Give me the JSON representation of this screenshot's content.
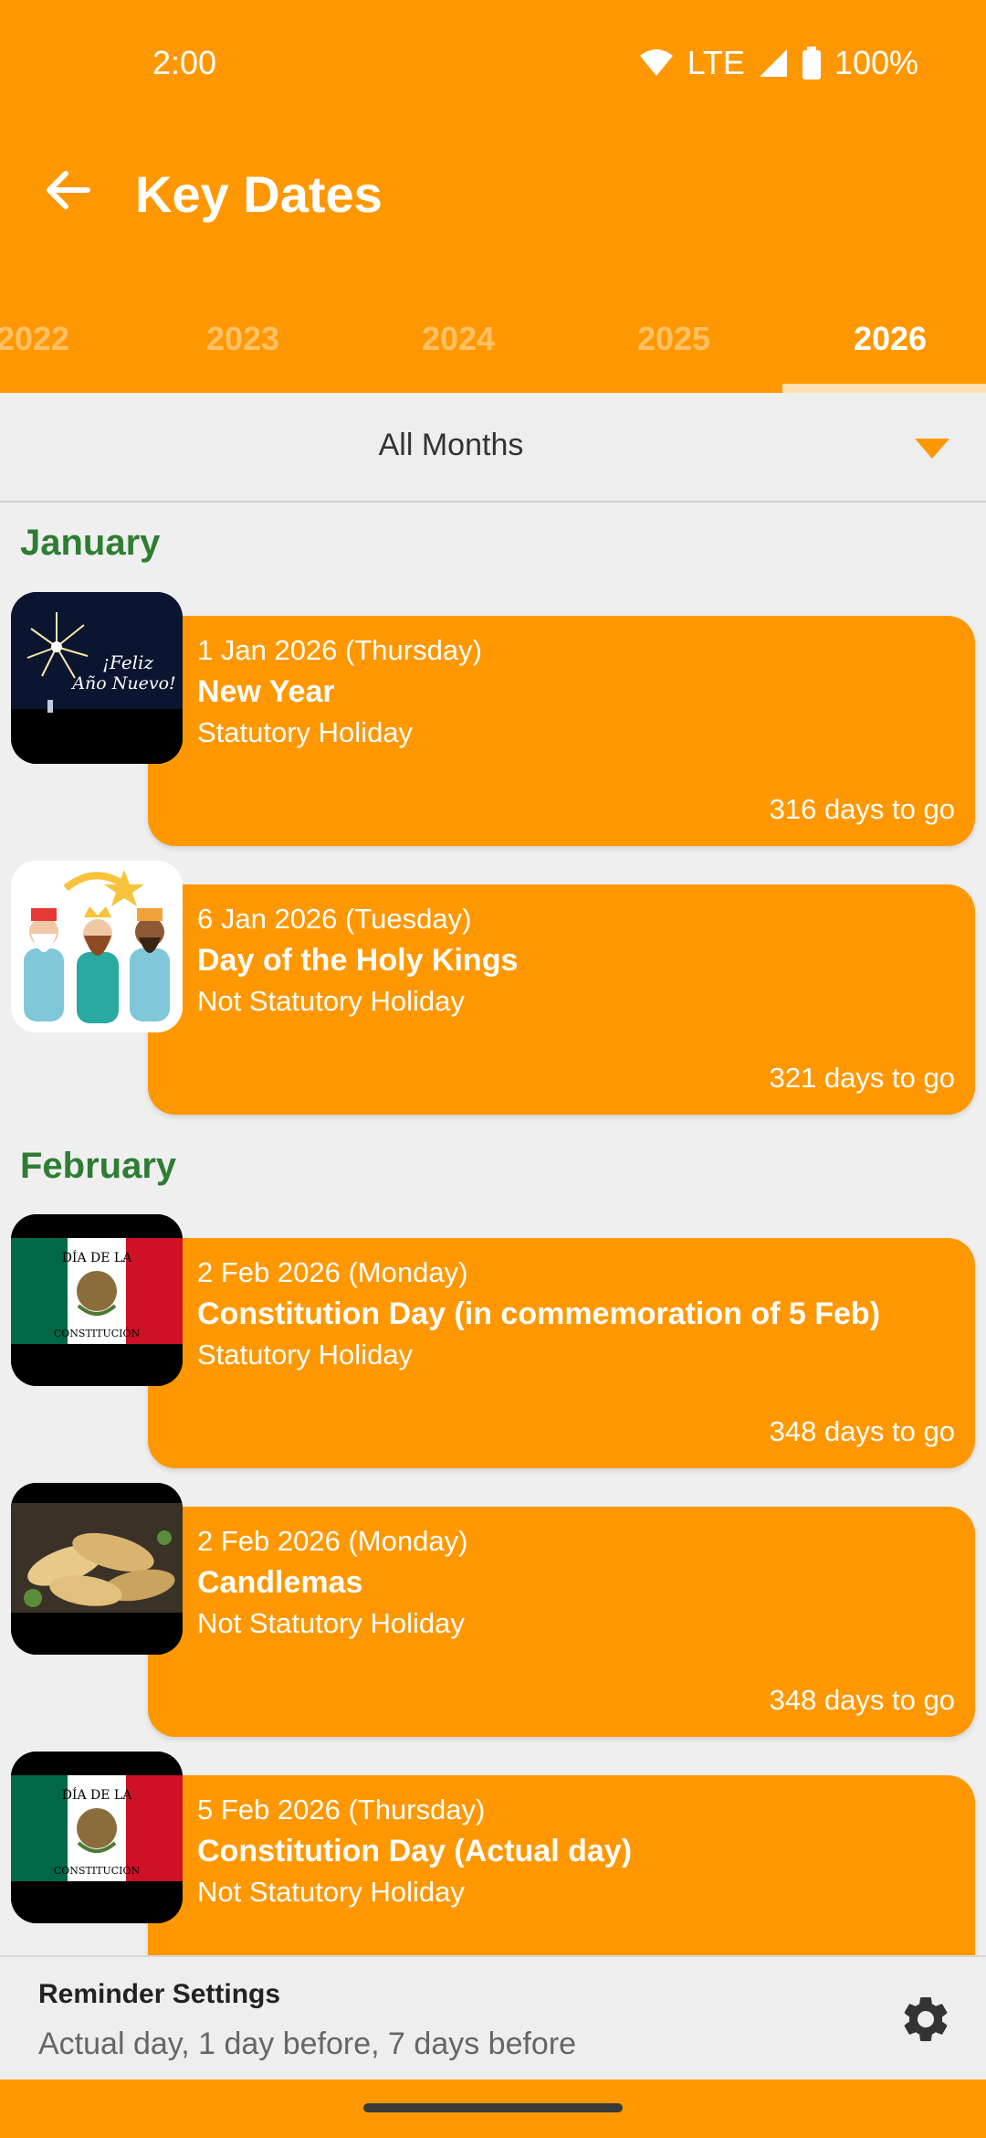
{
  "status": {
    "time": "2:00",
    "network": "LTE",
    "battery": "100%"
  },
  "appbar": {
    "title": "Key Dates",
    "back_icon": "arrow-back-icon"
  },
  "tabs": [
    {
      "label": "2022"
    },
    {
      "label": "2023"
    },
    {
      "label": "2024"
    },
    {
      "label": "2025"
    },
    {
      "label": "2026",
      "active": true
    }
  ],
  "filter": {
    "label": "All Months"
  },
  "months": [
    {
      "name": "January"
    },
    {
      "name": "February"
    }
  ],
  "events": [
    {
      "date": "1 Jan 2026 (Thursday)",
      "name": "New Year",
      "type": "Statutory Holiday",
      "togo": "316 days to go",
      "thumb_text_1": "¡Feliz",
      "thumb_text_2": "Año Nuevo!"
    },
    {
      "date": "6 Jan 2026 (Tuesday)",
      "name": "Day of the Holy Kings",
      "type": "Not Statutory Holiday",
      "togo": "321 days to go"
    },
    {
      "date": "2 Feb 2026 (Monday)",
      "name": "Constitution Day (in commemoration of 5 Feb)",
      "type": "Statutory Holiday",
      "togo": "348 days to go",
      "thumb_text_1": "DÍA DE LA",
      "thumb_text_2": "CONSTITUCIÓN"
    },
    {
      "date": "2 Feb 2026 (Monday)",
      "name": "Candlemas",
      "type": "Not Statutory Holiday",
      "togo": "348 days to go"
    },
    {
      "date": "5 Feb 2026 (Thursday)",
      "name": "Constitution Day (Actual day)",
      "type": "Not Statutory Holiday",
      "thumb_text_1": "DÍA DE LA",
      "thumb_text_2": "CONSTITUCIÓN"
    }
  ],
  "reminder": {
    "title": "Reminder Settings",
    "subtitle": "Actual day, 1 day before, 7 days before",
    "icon": "gear-icon"
  },
  "colors": {
    "primary": "#ff9800",
    "month_header": "#2e7d32",
    "background": "#efefef"
  }
}
